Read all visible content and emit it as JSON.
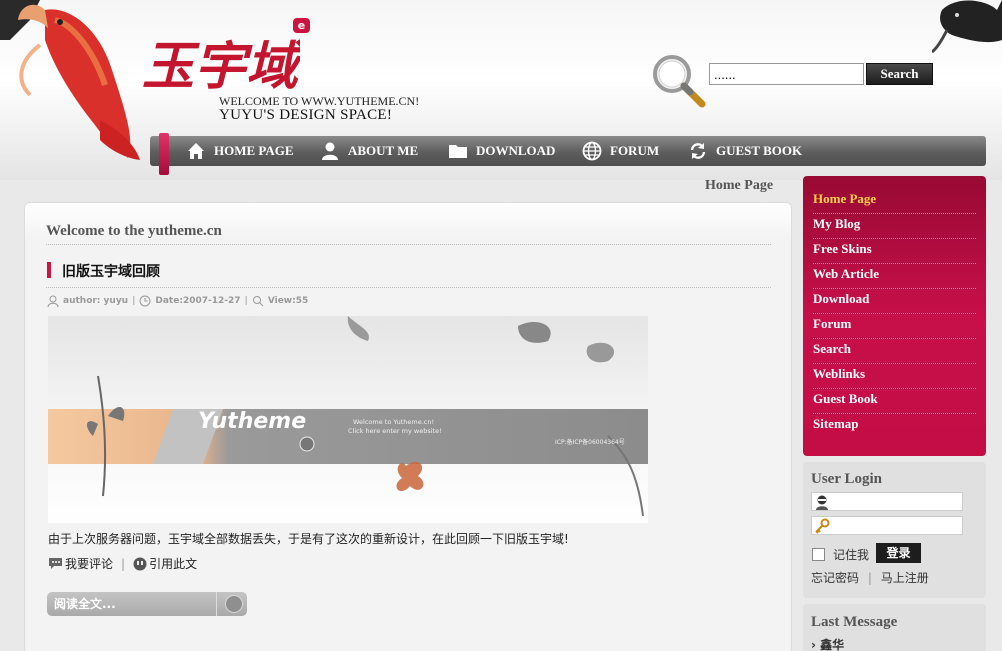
{
  "header": {
    "logo_text": "玉宇域",
    "logo_badge": "e",
    "welcome": "WELCOME TO WWW.YUTHEME.CN!",
    "tagline": "YUYU'S DESIGN SPACE!"
  },
  "search": {
    "value": "......",
    "button_label": "Search"
  },
  "nav": {
    "items": [
      {
        "label": "HOME PAGE",
        "icon": "home-icon"
      },
      {
        "label": "ABOUT ME",
        "icon": "user-icon"
      },
      {
        "label": "DOWNLOAD",
        "icon": "folder-icon"
      },
      {
        "label": "FORUM",
        "icon": "globe-icon"
      },
      {
        "label": "GUEST BOOK",
        "icon": "refresh-icon"
      }
    ]
  },
  "breadcrumb": "Home Page",
  "main": {
    "welcome_title": "Welcome to the yutheme.cn",
    "post": {
      "title": "旧版玉宇域回顾",
      "author": "author: yuyu",
      "date": "Date:2007-12-27",
      "views": "View:55",
      "banner_logo": "Yutheme",
      "banner_line1": "Welcome to Yutheme.cn!",
      "banner_line2": "Click here enter my website!",
      "banner_icp": "ICP:备ICP备06004364号",
      "body": "由于上次服务器问题，玉宇域全部数据丢失，于是有了这次的重新设计，在此回顾一下旧版玉宇域!",
      "comment_label": "我要评论",
      "quote_label": "引用此文",
      "read_more": "阅读全文..."
    }
  },
  "sidebar": {
    "menu": [
      {
        "label": "Home Page"
      },
      {
        "label": "My Blog"
      },
      {
        "label": "Free Skins"
      },
      {
        "label": "Web Article"
      },
      {
        "label": "Download"
      },
      {
        "label": "Forum"
      },
      {
        "label": "Search"
      },
      {
        "label": "Weblinks"
      },
      {
        "label": "Guest Book"
      },
      {
        "label": "Sitemap"
      }
    ],
    "login": {
      "title": "User Login",
      "remember_label": "记住我",
      "login_button": "登录",
      "forgot_label": "忘记密码",
      "register_label": "马上注册"
    },
    "messages": {
      "title": "Last Message",
      "items": [
        "鑫华"
      ]
    }
  },
  "colors": {
    "accent": "#c9153f",
    "nav_bg": "#5d5d5d",
    "active_menu": "#ffd24a"
  }
}
